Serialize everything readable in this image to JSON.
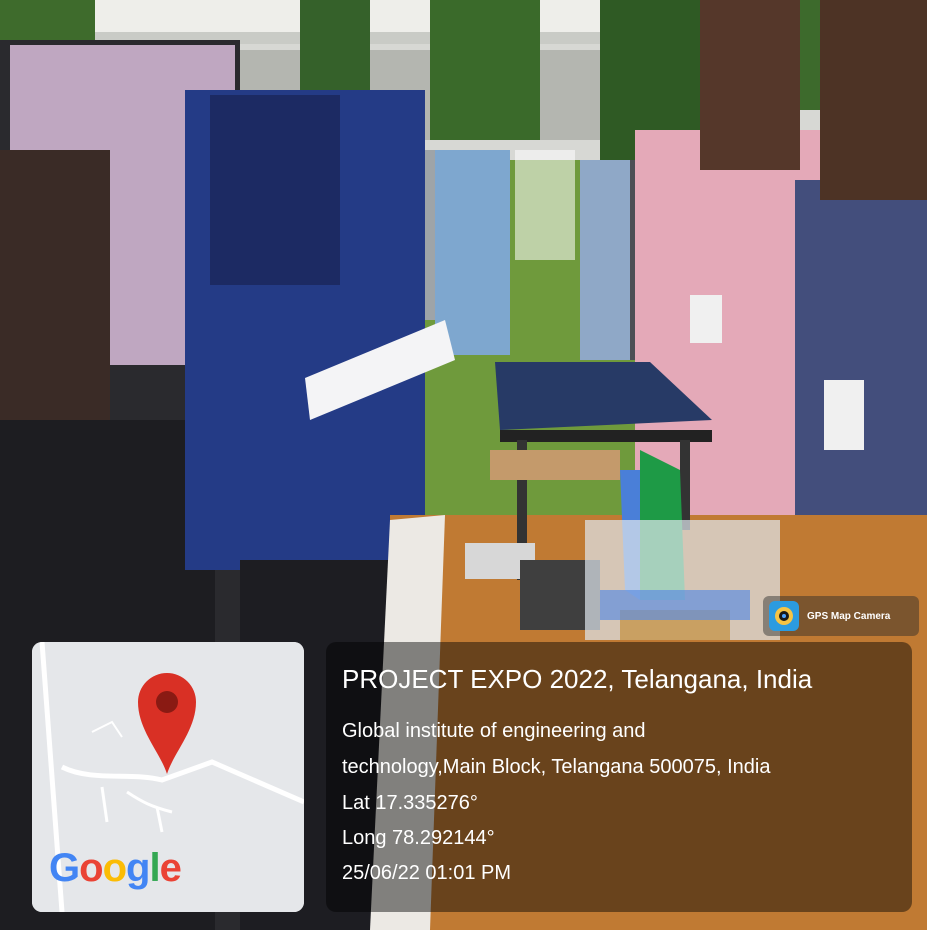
{
  "overlay": {
    "title": "PROJECT EXPO 2022, Telangana, India",
    "address_line1": "Global institute of engineering and",
    "address_line2": "technology,Main Block, Telangana 500075, India",
    "latitude": "Lat 17.335276°",
    "longitude": "Long 78.292144°",
    "datetime": "25/06/22 01:01 PM"
  },
  "badge": {
    "label": "GPS Map Camera",
    "icon": "camera-icon"
  },
  "map": {
    "logo_letters": [
      "G",
      "o",
      "o",
      "g",
      "l",
      "e"
    ],
    "logo_colors": [
      "#4285F4",
      "#EA4335",
      "#FBBC05",
      "#4285F4",
      "#34A853",
      "#EA4335"
    ],
    "pin_color": "#d93025",
    "pin_icon": "map-pin-icon"
  },
  "colors": {
    "overlay_bg": "rgba(0,0,0,0.45)",
    "grass": "#6f9a3c",
    "table_wood": "#c07a33"
  }
}
